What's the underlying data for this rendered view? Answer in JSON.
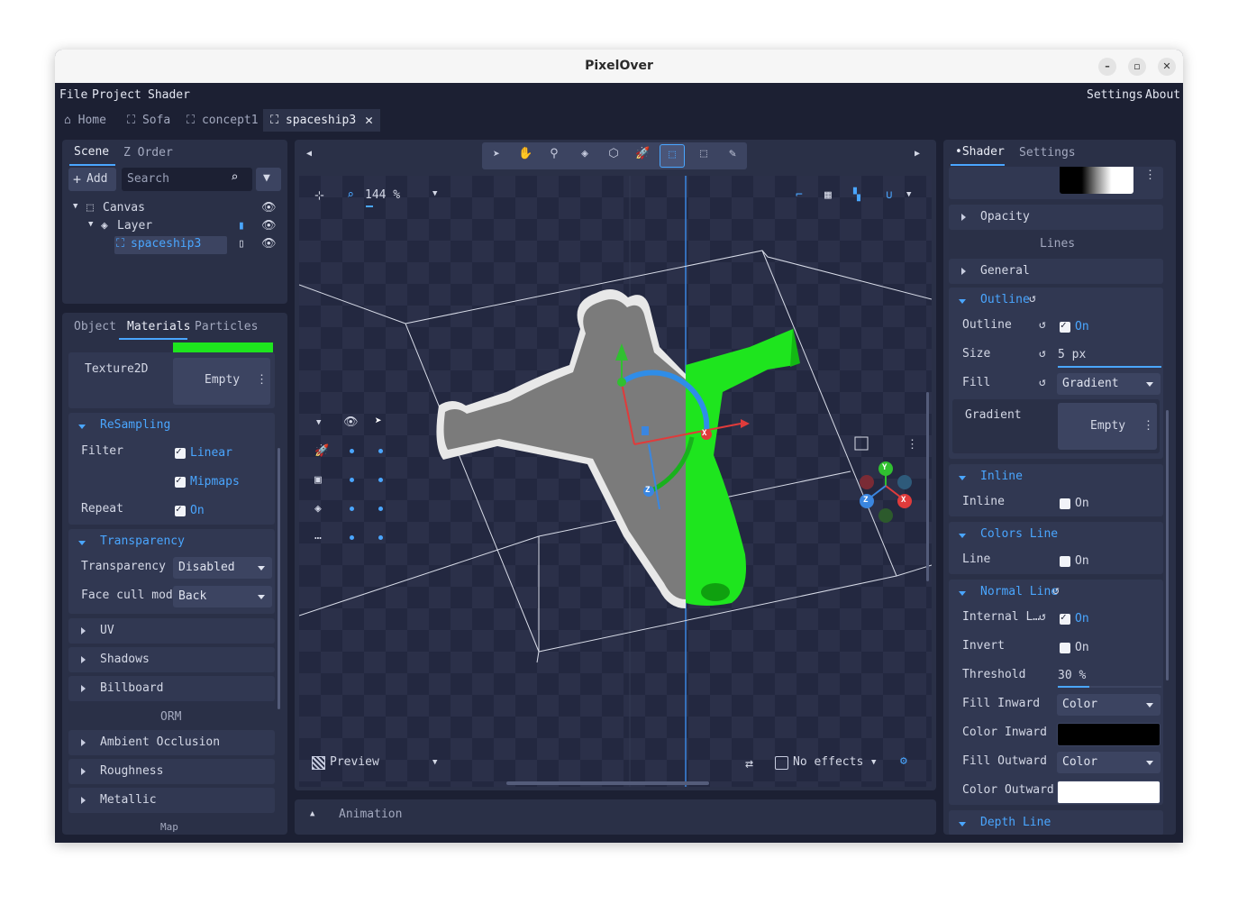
{
  "window": {
    "title": "PixelOver"
  },
  "menu": {
    "file": "File",
    "project": "Project",
    "shader": "Shader",
    "settings": "Settings",
    "about": "About"
  },
  "tabs": [
    {
      "label": "Home"
    },
    {
      "label": "Sofa"
    },
    {
      "label": "concept1"
    },
    {
      "label": "spaceship3"
    }
  ],
  "scene_panel": {
    "tab_scene": "Scene",
    "tab_zorder": "Z Order",
    "add_label": "Add",
    "search_placeholder": "Search",
    "tree": {
      "canvas": "Canvas",
      "layer": "Layer",
      "sprite": "spaceship3"
    }
  },
  "props_panel": {
    "tab_object": "Object",
    "tab_materials": "Materials",
    "tab_particles": "Particles",
    "texture_label": "Texture2D",
    "texture_value": "Empty",
    "resampling": {
      "title": "ReSampling",
      "filter": "Filter",
      "linear": "Linear",
      "mipmaps": "Mipmaps",
      "repeat": "Repeat",
      "on": "On"
    },
    "transparency": {
      "title": "Transparency",
      "label": "Transparency",
      "value": "Disabled",
      "face_cull_label": "Face cull mode",
      "face_cull_value": "Back"
    },
    "sections": [
      "UV",
      "Shadows",
      "Billboard"
    ],
    "orm_heading": "ORM",
    "orm_sections": [
      "Ambient Occlusion",
      "Roughness",
      "Metallic"
    ],
    "cut_heading": "Map"
  },
  "viewport": {
    "zoom": "144 %",
    "preview_label": "Preview",
    "no_effects_label": "No effects",
    "animation_label": "Animation",
    "gizmo_axes": {
      "x": "X",
      "y": "Y",
      "z": "Z"
    }
  },
  "shader_panel": {
    "tab_shader": "Shader",
    "tab_settings": "Settings",
    "opacity": "Opacity",
    "lines_heading": "Lines",
    "general": "General",
    "outline": {
      "title": "Outline",
      "outline_label": "Outline",
      "on": "On",
      "size_label": "Size",
      "size_value": "5 px",
      "fill_label": "Fill",
      "fill_value": "Gradient",
      "gradient_label": "Gradient",
      "gradient_value": "Empty"
    },
    "inline": {
      "title": "Inline",
      "label": "Inline",
      "on": "On"
    },
    "colors_line": {
      "title": "Colors Line",
      "label": "Line",
      "on": "On"
    },
    "normal_line": {
      "title": "Normal Line",
      "internal_label": "Internal L…",
      "on": "On",
      "invert_label": "Invert",
      "invert_on": "On",
      "threshold_label": "Threshold",
      "threshold_value": "30 %",
      "threshold_level": 0.3,
      "fill_inward_label": "Fill Inward",
      "fill_inward_value": "Color",
      "color_inward_label": "Color Inward",
      "color_inward": "#000000",
      "fill_outward_label": "Fill Outward",
      "fill_outward_value": "Color",
      "color_outward_label": "Color Outward",
      "color_outward": "#ffffff"
    },
    "depth_line": "Depth Line"
  },
  "colors": {
    "accent": "#4aa6ff",
    "material_green": "#1ee51e",
    "bg": "#1c2033",
    "panel": "#2a3047"
  }
}
